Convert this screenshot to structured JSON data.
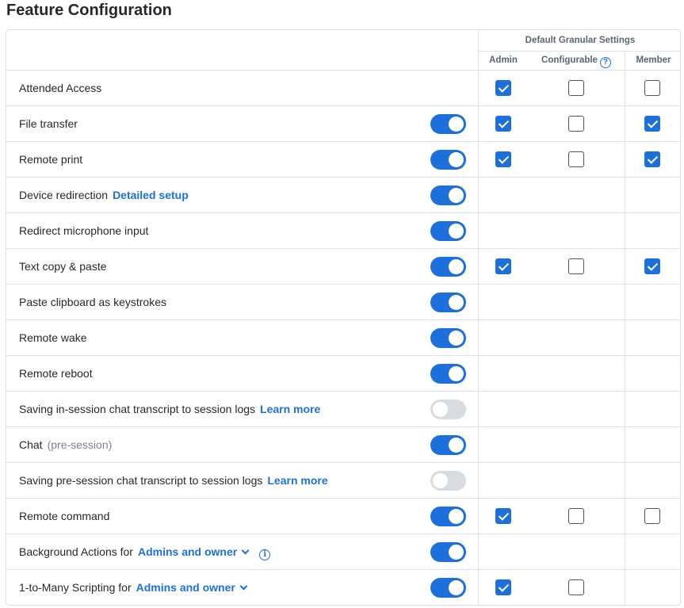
{
  "page_title": "Feature Configuration",
  "table": {
    "group_header": "Default Granular Settings",
    "columns": {
      "admin": "Admin",
      "configurable": "Configurable",
      "member": "Member"
    },
    "help_icon": "question-circle-icon"
  },
  "rows": [
    {
      "label": "Attended Access",
      "toggle": null,
      "checks": {
        "admin": true,
        "configurable": false,
        "member": false
      }
    },
    {
      "label": "File transfer",
      "toggle": true,
      "checks": {
        "admin": true,
        "configurable": false,
        "member": true
      }
    },
    {
      "label": "Remote print",
      "toggle": true,
      "checks": {
        "admin": true,
        "configurable": false,
        "member": true
      }
    },
    {
      "label": "Device redirection",
      "link": "Detailed setup",
      "toggle": true,
      "checks": null
    },
    {
      "label": "Redirect microphone input",
      "toggle": true,
      "checks": null
    },
    {
      "label": "Text copy & paste",
      "toggle": true,
      "checks": {
        "admin": true,
        "configurable": false,
        "member": true
      }
    },
    {
      "label": "Paste clipboard as keystrokes",
      "toggle": true,
      "checks": null
    },
    {
      "label": "Remote wake",
      "toggle": true,
      "checks": null
    },
    {
      "label": "Remote reboot",
      "toggle": true,
      "checks": null
    },
    {
      "label": "Saving in-session chat transcript to session logs",
      "link": "Learn more",
      "toggle": false,
      "checks": null
    },
    {
      "label": "Chat",
      "muted": "(pre-session)",
      "toggle": true,
      "checks": null
    },
    {
      "label": "Saving pre-session chat transcript to session logs",
      "link": "Learn more",
      "toggle": false,
      "checks": null
    },
    {
      "label": "Remote command",
      "toggle": true,
      "checks": {
        "admin": true,
        "configurable": false,
        "member": false
      }
    },
    {
      "label": "Background Actions for",
      "dropdown": "Admins and owner",
      "info": true,
      "toggle": true,
      "checks": null
    },
    {
      "label": "1-to-Many Scripting for",
      "dropdown": "Admins and owner",
      "toggle": true,
      "checks": {
        "admin": true,
        "configurable": false,
        "member": null
      }
    }
  ],
  "colors": {
    "accent": "#1d6fdc",
    "toggle_off": "#d8dbe0",
    "border": "#dfe1e6"
  }
}
